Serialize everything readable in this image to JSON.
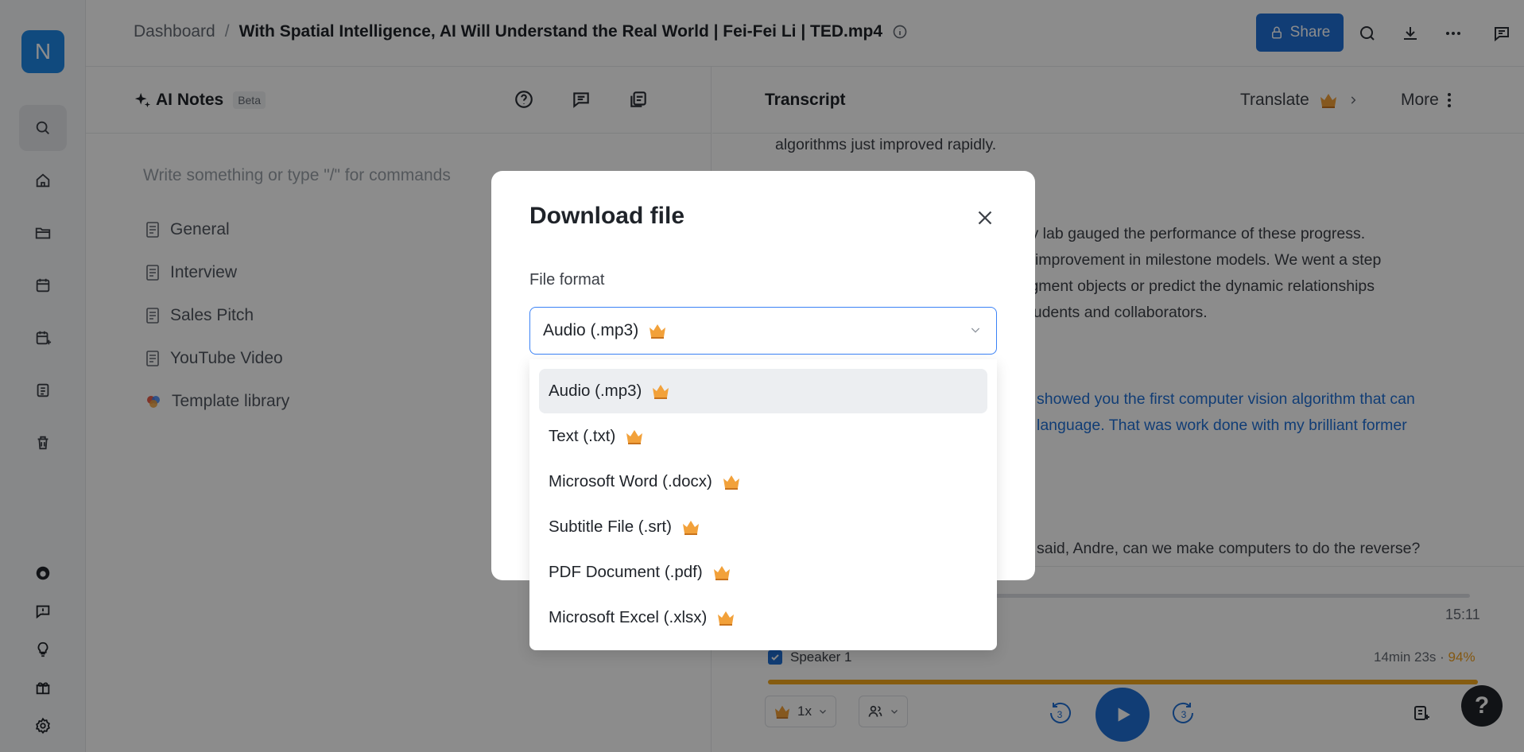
{
  "rail": {
    "avatar_letter": "N",
    "items": [
      "search",
      "home",
      "folder",
      "calendar",
      "calendar-plus",
      "notes",
      "trash"
    ],
    "bottom_items": [
      "logo",
      "feedback",
      "idea",
      "gift",
      "settings"
    ]
  },
  "header": {
    "breadcrumb_root": "Dashboard",
    "breadcrumb_sep": "/",
    "file_title": "With Spatial Intelligence, AI Will Understand the Real World | Fei-Fei Li | TED.mp4",
    "share_label": "Share"
  },
  "ai_notes": {
    "title": "AI Notes",
    "badge": "Beta",
    "placeholder": "Write something or type \"/\" for commands",
    "templates": [
      "General",
      "Interview",
      "Sales Pitch",
      "YouTube Video"
    ],
    "template_library": "Template library"
  },
  "transcript": {
    "title": "Transcript",
    "translate_label": "Translate",
    "more_label": "More",
    "lines": [
      {
        "text": "algorithms just improved rapidly.",
        "blue": false
      },
      {
        "text": "d by my lab gauged the performance of these progress.",
        "blue": false
      },
      {
        "text": "annual improvement in milestone models. We went a step",
        "blue": false
      },
      {
        "text": "can segment objects or predict the dynamic relationships",
        "blue": false
      },
      {
        "text": "y my students and collaborators.",
        "blue": false
      },
      {
        "text": "showed you the first computer vision algorithm that can",
        "blue": true
      },
      {
        "text": "language. That was work done with my brilliant former",
        "blue": true
      },
      {
        "text": "said, Andre, can we make computers to do the reverse?",
        "blue": false
      }
    ]
  },
  "player": {
    "duration": "15:11",
    "speaker_name": "Speaker 1",
    "speaker_time": "14min 23s",
    "speaker_sep": " · ",
    "speaker_pct": "94%",
    "speed": "1x",
    "skip_back": "3",
    "skip_fwd": "3",
    "speaker_share": 0.94
  },
  "modal": {
    "title": "Download file",
    "format_label": "File format",
    "selected": "Audio (.mp3)",
    "options": [
      "Audio (.mp3)",
      "Text (.txt)",
      "Microsoft Word (.docx)",
      "Subtitle File (.srt)",
      "PDF Document (.pdf)",
      "Microsoft Excel (.xlsx)"
    ]
  },
  "colors": {
    "accent": "#1f6fd6",
    "crown": "#f2a13a",
    "overlay": "rgba(0,0,0,0.45)"
  }
}
